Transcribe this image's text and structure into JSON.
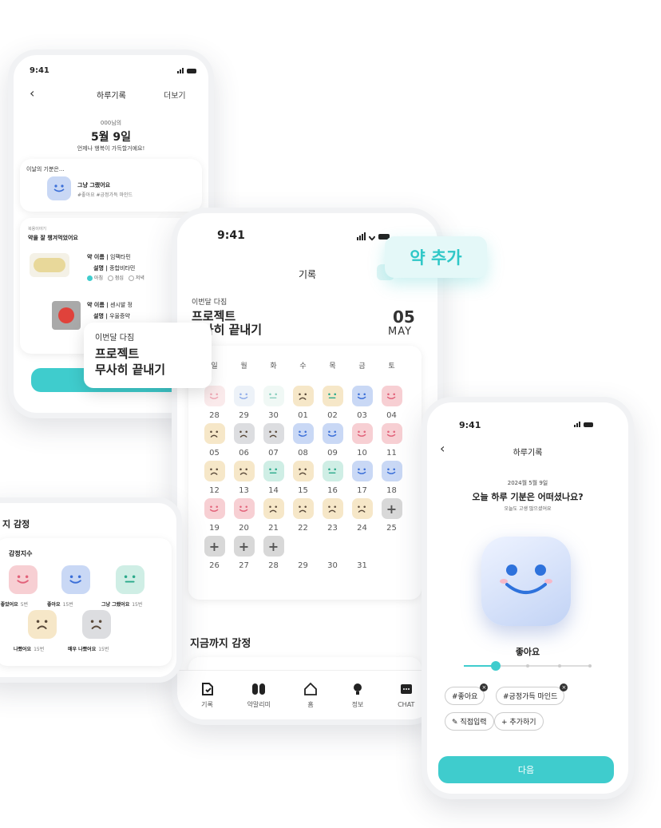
{
  "phone1": {
    "time": "9:41",
    "title": "하루기록",
    "more_label": "더보기",
    "user": "000님의",
    "date": "5월 9일",
    "subtitle": "언제나 행복이 가득할거예요!",
    "mood_heading": "이날의 기분은...",
    "mood_text": "그냥 그랬어요",
    "mood_tags": "#좋아요 #긍정가득 마인드",
    "record_small": "복용이야기",
    "record_heading": "약을 잘 챙겨먹었어요",
    "med1_name_label": "약 이름 |",
    "med1_name": "임팩타민",
    "med1_desc_label": "설명 |",
    "med1_desc": "종합비타민",
    "med1_times": [
      "아침",
      "점심",
      "저녁"
    ],
    "med2_name_label": "약 이름 |",
    "med2_name": "센시발 정",
    "med2_desc_label": "설명 |",
    "med2_desc": "우울증약"
  },
  "callouts": {
    "add_med": "약 추가",
    "goal_label": "이번달 다짐",
    "goal_line1": "프로젝트",
    "goal_line2": "무사히 끝내기"
  },
  "phone2": {
    "time": "9:41",
    "title": "기록",
    "goal_label": "이번달 다짐",
    "goal_line1": "프로젝트",
    "goal_line2": "무사히 끝내기",
    "day": "05",
    "month": "MAY",
    "weekdays": [
      "일",
      "월",
      "화",
      "수",
      "목",
      "금",
      "토"
    ],
    "weeks": [
      [
        [
          "28",
          "happy",
          "#f6d9dc"
        ],
        [
          "29",
          "smile",
          "#dfe9f3"
        ],
        [
          "30",
          "neutral",
          "#e4f3ee"
        ],
        [
          "01",
          "sad",
          "#f6e7c8"
        ],
        [
          "02",
          "neutral",
          "#f6e7c8"
        ],
        [
          "03",
          "smile",
          "#c9d8f5"
        ],
        [
          "04",
          "happy",
          "#f7cfd3"
        ]
      ],
      [
        [
          "05",
          "sad",
          "#f6e7c8"
        ],
        [
          "06",
          "sad",
          "#dcdde0"
        ],
        [
          "07",
          "sad",
          "#dcdde0"
        ],
        [
          "08",
          "smile",
          "#c9d8f5"
        ],
        [
          "09",
          "smile",
          "#c9d8f5"
        ],
        [
          "10",
          "happy",
          "#f7cfd3"
        ],
        [
          "11",
          "happy",
          "#f7cfd3"
        ]
      ],
      [
        [
          "12",
          "sad",
          "#f6e7c8"
        ],
        [
          "13",
          "sad",
          "#f6e7c8"
        ],
        [
          "14",
          "neutral",
          "#cfeee5"
        ],
        [
          "15",
          "sad",
          "#f6e7c8"
        ],
        [
          "16",
          "neutral",
          "#cfeee5"
        ],
        [
          "17",
          "smile",
          "#c9d8f5"
        ],
        [
          "18",
          "smile",
          "#c9d8f5"
        ]
      ],
      [
        [
          "19",
          "happy",
          "#f7cfd3"
        ],
        [
          "20",
          "happy",
          "#f7cfd3"
        ],
        [
          "21",
          "sad",
          "#f6e7c8"
        ],
        [
          "22",
          "sad",
          "#f6e7c8"
        ],
        [
          "23",
          "sad",
          "#f6e7c8"
        ],
        [
          "24",
          "sad",
          "#f6e7c8"
        ],
        [
          "25",
          "plus",
          ""
        ]
      ],
      [
        [
          "26",
          "plus",
          ""
        ],
        [
          "27",
          "plus",
          ""
        ],
        [
          "28",
          "plus",
          ""
        ],
        [
          "29",
          "empty",
          ""
        ],
        [
          "30",
          "empty",
          ""
        ],
        [
          "31",
          "empty",
          ""
        ],
        [
          "",
          "empty",
          ""
        ]
      ]
    ],
    "section_title": "지금까지 감정",
    "nav": [
      "기록",
      "약말리미",
      "홈",
      "정보",
      "CHAT"
    ]
  },
  "phone3": {
    "time": "9:41",
    "title": "하루기록",
    "date": "2024월 5월 9일",
    "question": "오늘 하루 기분은 어떠셨나요?",
    "sub": "오늘도 고생 많으셨어요",
    "mood_label": "좋아요",
    "slider_level": 0.25,
    "tags": [
      "#좋아요",
      "#긍정가득 마인드"
    ],
    "actions": [
      "직접입력",
      "추가하기"
    ],
    "next": "다음"
  },
  "card4": {
    "title": "지 감정",
    "subtitle": "감정지수",
    "items": [
      {
        "label": "우 좋았어요",
        "count": "5번",
        "face": "happy",
        "color": "#f7cfd3"
      },
      {
        "label": "좋아요",
        "count": "15번",
        "face": "smile",
        "color": "#c9d8f5"
      },
      {
        "label": "그냥 그랬어요",
        "count": "15번",
        "face": "neutral",
        "color": "#cfeee5"
      },
      {
        "label": "나빴어요",
        "count": "15번",
        "face": "sad",
        "color": "#f6e7c8"
      },
      {
        "label": "매우 나빴어요",
        "count": "15번",
        "face": "sad",
        "color": "#dcdde0"
      }
    ]
  }
}
